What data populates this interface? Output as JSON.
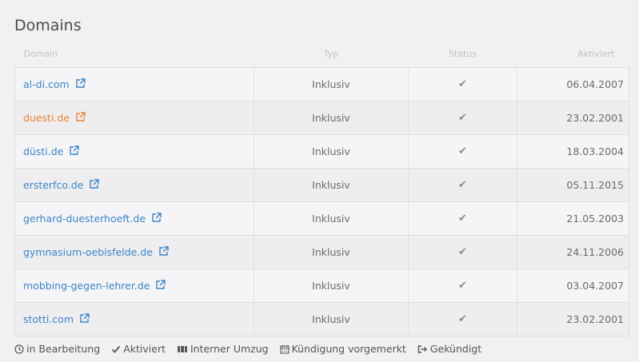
{
  "title": "Domains",
  "columns": {
    "domain": "Domain",
    "typ": "Typ",
    "status": "Status",
    "aktiviert": "Aktiviert"
  },
  "rows": [
    {
      "domain": "al-di.com",
      "typ": "Inklusiv",
      "status": "✔",
      "aktiviert": "06.04.2007",
      "highlighted": false
    },
    {
      "domain": "duesti.de",
      "typ": "Inklusiv",
      "status": "✔",
      "aktiviert": "23.02.2001",
      "highlighted": true
    },
    {
      "domain": "düsti.de",
      "typ": "Inklusiv",
      "status": "✔",
      "aktiviert": "18.03.2004",
      "highlighted": false
    },
    {
      "domain": "ersterfco.de",
      "typ": "Inklusiv",
      "status": "✔",
      "aktiviert": "05.11.2015",
      "highlighted": false
    },
    {
      "domain": "gerhard-duesterhoeft.de",
      "typ": "Inklusiv",
      "status": "✔",
      "aktiviert": "21.05.2003",
      "highlighted": false
    },
    {
      "domain": "gymnasium-oebisfelde.de",
      "typ": "Inklusiv",
      "status": "✔",
      "aktiviert": "24.11.2006",
      "highlighted": false
    },
    {
      "domain": "mobbing-gegen-lehrer.de",
      "typ": "Inklusiv",
      "status": "✔",
      "aktiviert": "03.04.2007",
      "highlighted": false
    },
    {
      "domain": "stotti.com",
      "typ": "Inklusiv",
      "status": "✔",
      "aktiviert": "23.02.2001",
      "highlighted": false
    }
  ],
  "legend": [
    {
      "icon": "clock-icon",
      "label": "in Bearbeitung"
    },
    {
      "icon": "check-icon",
      "label": "Aktiviert"
    },
    {
      "icon": "truck-icon",
      "label": "Interner Umzug"
    },
    {
      "icon": "calendar-icon",
      "label": "Kündigung vorgemerkt"
    },
    {
      "icon": "sign-out-icon",
      "label": "Gekündigt"
    }
  ],
  "colors": {
    "link": "#3d84c6",
    "link_highlight": "#ee8433",
    "background": "#f1f1f2"
  }
}
